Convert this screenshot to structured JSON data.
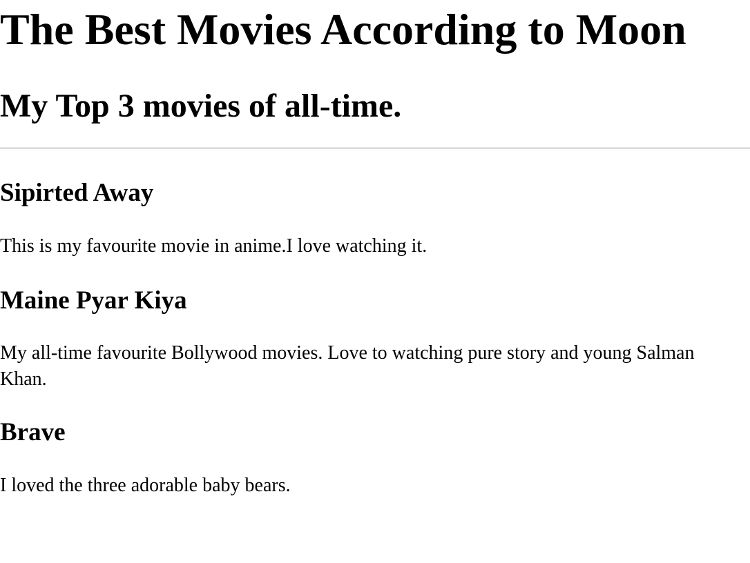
{
  "page": {
    "title": "The Best Movies According to Moon",
    "subtitle": "My Top 3 movies of all-time."
  },
  "movies": [
    {
      "title": "Sipirted Away",
      "description": "This is my favourite movie in anime.I love watching it."
    },
    {
      "title": "Maine Pyar Kiya",
      "description": "My all-time favourite Bollywood movies. Love to watching pure story and young Salman Khan."
    },
    {
      "title": "Brave",
      "description": "I loved the three adorable baby bears."
    }
  ]
}
